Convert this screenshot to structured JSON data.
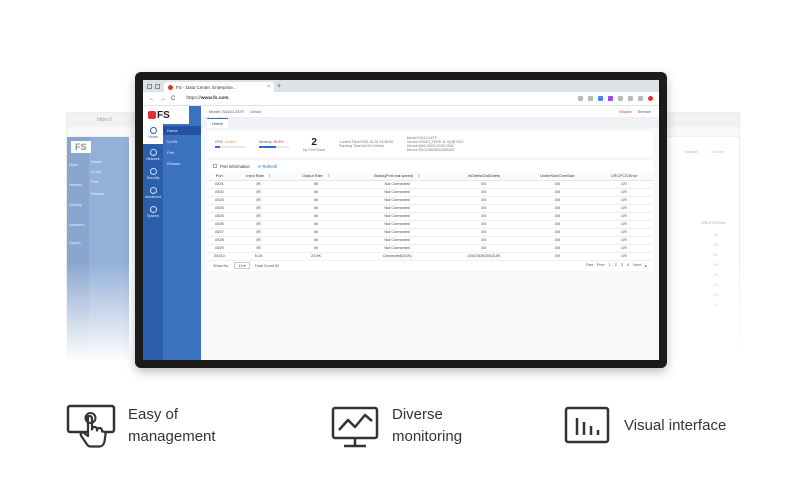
{
  "browser": {
    "tab_title": "FS - Data Center, Enterprise...",
    "tab_close": "×",
    "new_tab": "+",
    "url_prefix": "https://",
    "url_domain": "www.fs.com",
    "nav_back": "←",
    "nav_forward": "→",
    "nav_reload": "C"
  },
  "app": {
    "logo_text": "FS",
    "sidebar": [
      {
        "label": "Home",
        "icon": "home-icon"
      },
      {
        "label": "Network",
        "icon": "network-icon"
      },
      {
        "label": "Security",
        "icon": "security-icon"
      },
      {
        "label": "Advanced",
        "icon": "advanced-icon"
      },
      {
        "label": "System",
        "icon": "system-icon"
      }
    ],
    "subnav": [
      "Home",
      "VLAN",
      "Port",
      "Restart"
    ],
    "header": {
      "model": "Model: S3410-24TF",
      "detail_link": "Detail",
      "wizard": "Wizard",
      "service": "Service"
    },
    "page_tab": "Home",
    "info": {
      "cpu_label": "CPU",
      "cpu_value": "14.66%",
      "cpu_fraction": 0.15,
      "memory_label": "Memory",
      "memory_value": "55.8%",
      "memory_fraction": 0.56,
      "up_count": "2",
      "up_label": "Up Port Count",
      "current_time": "Current Time:2020-10-28 14:38:50",
      "running_time": "Running Time:0d 00 h 03min",
      "model_line": "Model:S3410-24TF",
      "version_line": "Version:S3410_FSOS 11.4(1)B74S2",
      "mac_line": "Device MAC:00E0.9C00.2340",
      "sn_line": "Device SN:G1MA0B1000A001"
    },
    "port_section": {
      "title": "Port Information",
      "refresh": "Refresh",
      "columns": [
        "Port",
        "Input Rate",
        "Output Rate",
        "Status(Port real speed)",
        "InOctets/OutOctets",
        "UnderSize/OverSize",
        "CRC/FCS Error"
      ],
      "rows": [
        [
          "Gi0/1",
          "0K",
          "0K",
          "Not Connected",
          "0/0",
          "0/0",
          "0/0"
        ],
        [
          "Gi0/2",
          "0K",
          "0K",
          "Not Connected",
          "0/0",
          "0/0",
          "0/0"
        ],
        [
          "Gi0/3",
          "0K",
          "0K",
          "Not Connected",
          "0/0",
          "0/0",
          "0/0"
        ],
        [
          "Gi0/4",
          "0K",
          "0K",
          "Not Connected",
          "0/0",
          "0/0",
          "0/0"
        ],
        [
          "Gi0/5",
          "0K",
          "0K",
          "Not Connected",
          "0/0",
          "0/0",
          "0/0"
        ],
        [
          "Gi0/6",
          "0K",
          "0K",
          "Not Connected",
          "0/0",
          "0/0",
          "0/0"
        ],
        [
          "Gi0/7",
          "0K",
          "0K",
          "Not Connected",
          "0/0",
          "0/0",
          "0/0"
        ],
        [
          "Gi0/8",
          "0K",
          "0K",
          "Not Connected",
          "0/0",
          "0/0",
          "0/0"
        ],
        [
          "Gi0/9",
          "0K",
          "0K",
          "Not Connected",
          "0/0",
          "0/0",
          "0/0"
        ],
        [
          "Gi0/10",
          "5.1K",
          "23.9K",
          "Connected(1G/b)",
          "15647839/2552159",
          "0/0",
          "0/0"
        ]
      ],
      "show_label": "Show No:",
      "show_value": "10",
      "total": "Total Count:32",
      "first": "First",
      "prev": "Prev",
      "pages": [
        "1",
        "2",
        "3",
        "4"
      ],
      "next": "Next"
    }
  },
  "features": [
    {
      "label": "Easy of\nmanagement",
      "icon": "touch-screen-icon"
    },
    {
      "label": "Diverse\nmonitoring",
      "icon": "monitor-chart-icon"
    },
    {
      "label": "Visual interface",
      "icon": "bar-chart-icon"
    }
  ],
  "colors": {
    "sidebar": "#2b5fab",
    "subnav": "#3a72bf",
    "accent": "#2b6bd6",
    "brand_red": "#e0312f"
  }
}
